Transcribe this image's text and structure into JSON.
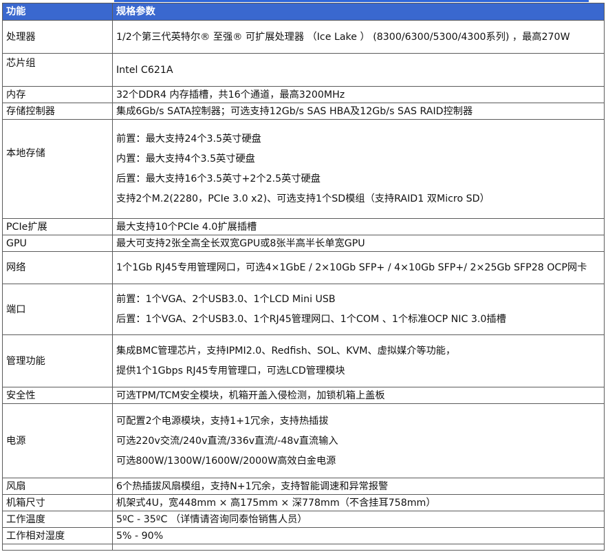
{
  "header": {
    "col1": "功能",
    "col2": "规格参数"
  },
  "rows": [
    {
      "label": "处理器",
      "lines": [
        "1/2个第三代英特尔® 至强® 可扩展处理器 （Ice Lake ） (8300/6300/5300/4300系列) ，最高270W"
      ]
    },
    {
      "label": "芯片组",
      "lines": [
        "Intel C621A"
      ]
    },
    {
      "label": "内存",
      "lines": [
        "32个DDR4 内存插槽，共16个通道，最高3200MHz"
      ]
    },
    {
      "label": "存储控制器",
      "lines": [
        "集成6Gb/s SATA控制器；可选支持12Gb/s SAS HBA及12Gb/s SAS RAID控制器"
      ]
    },
    {
      "label": "本地存储",
      "lines": [
        "前置：最大支持24个3.5英寸硬盘",
        "内置：最大支持4个3.5英寸硬盘",
        "后置：最大支持16个3.5英寸+2个2.5英寸硬盘",
        "支持2个M.2(2280，PCIe 3.0 x2)、可选支持1个SD模组（支持RAID1 双Micro SD）"
      ]
    },
    {
      "label": "PCIe扩展",
      "lines": [
        "最大支持10个PCIe 4.0扩展插槽"
      ]
    },
    {
      "label": "GPU",
      "lines": [
        "最大可支持2张全高全长双宽GPU或8张半高半长单宽GPU"
      ]
    },
    {
      "label": "网络",
      "lines": [
        "1个1Gb RJ45专用管理网口，可选4×1GbE / 2×10Gb SFP+ / 4×10Gb SFP+/ 2×25Gb SFP28 OCP网卡"
      ]
    },
    {
      "label": "端口",
      "lines": [
        "前置：1个VGA、2个USB3.0、1个LCD Mini USB",
        "后置：1个VGA、2个USB3.0、1个RJ45管理网口、1个COM 、1个标准OCP NIC 3.0插槽"
      ]
    },
    {
      "label": "管理功能",
      "lines": [
        "集成BMC管理芯片，支持IPMI2.0、Redfish、SOL、KVM、虚拟媒介等功能，",
        "提供1个1Gbps RJ45专用管理口，可选LCD管理模块"
      ]
    },
    {
      "label": "安全性",
      "lines": [
        "可选TPM/TCM安全模块，机箱开盖入侵检测，加锁机箱上盖板"
      ]
    },
    {
      "label": "电源",
      "lines": [
        "可配置2个电源模块，支持1+1冗余，支持热插拔",
        "可选220v交流/240v直流/336v直流/-48v直流输入",
        "可选800W/1300W/1600W/2000W高效白金电源"
      ]
    },
    {
      "label": "风扇",
      "lines": [
        "6个热插拔风扇模组，支持N+1冗余，支持智能调速和异常报警"
      ]
    },
    {
      "label": "机箱尺寸",
      "lines": [
        "机架式4U，宽448mm × 高175mm × 深778mm（不含挂耳758mm）"
      ]
    },
    {
      "label": "工作温度",
      "lines": [
        "5ºC - 35ºC （详情请咨询同泰怡销售人员）"
      ]
    },
    {
      "label": "工作相对湿度",
      "lines": [
        "5% - 90%"
      ]
    }
  ]
}
